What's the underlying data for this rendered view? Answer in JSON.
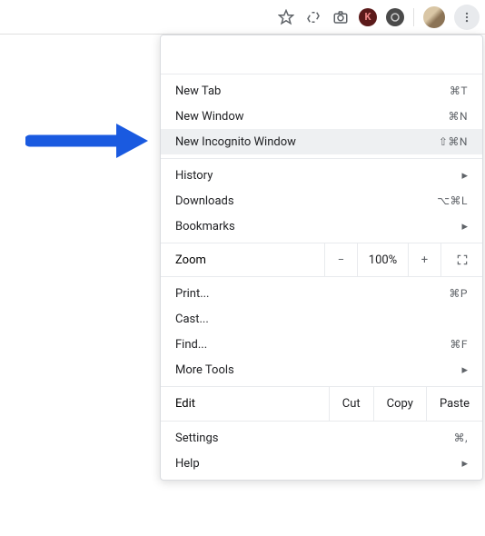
{
  "toolbar": {
    "ext_k_label": "K"
  },
  "menu": {
    "group1": [
      {
        "label": "New Tab",
        "shortcut": "⌘T"
      },
      {
        "label": "New Window",
        "shortcut": "⌘N"
      },
      {
        "label": "New Incognito Window",
        "shortcut": "⇧⌘N",
        "highlighted": true
      }
    ],
    "group2": [
      {
        "label": "History",
        "submenu": true
      },
      {
        "label": "Downloads",
        "shortcut": "⌥⌘L"
      },
      {
        "label": "Bookmarks",
        "submenu": true
      }
    ],
    "zoom": {
      "label": "Zoom",
      "minus": "−",
      "level": "100%",
      "plus": "+"
    },
    "group3": [
      {
        "label": "Print...",
        "shortcut": "⌘P"
      },
      {
        "label": "Cast..."
      },
      {
        "label": "Find...",
        "shortcut": "⌘F"
      },
      {
        "label": "More Tools",
        "submenu": true
      }
    ],
    "edit": {
      "label": "Edit",
      "cut": "Cut",
      "copy": "Copy",
      "paste": "Paste"
    },
    "group4": [
      {
        "label": "Settings",
        "shortcut": "⌘,"
      },
      {
        "label": "Help",
        "submenu": true
      }
    ]
  }
}
